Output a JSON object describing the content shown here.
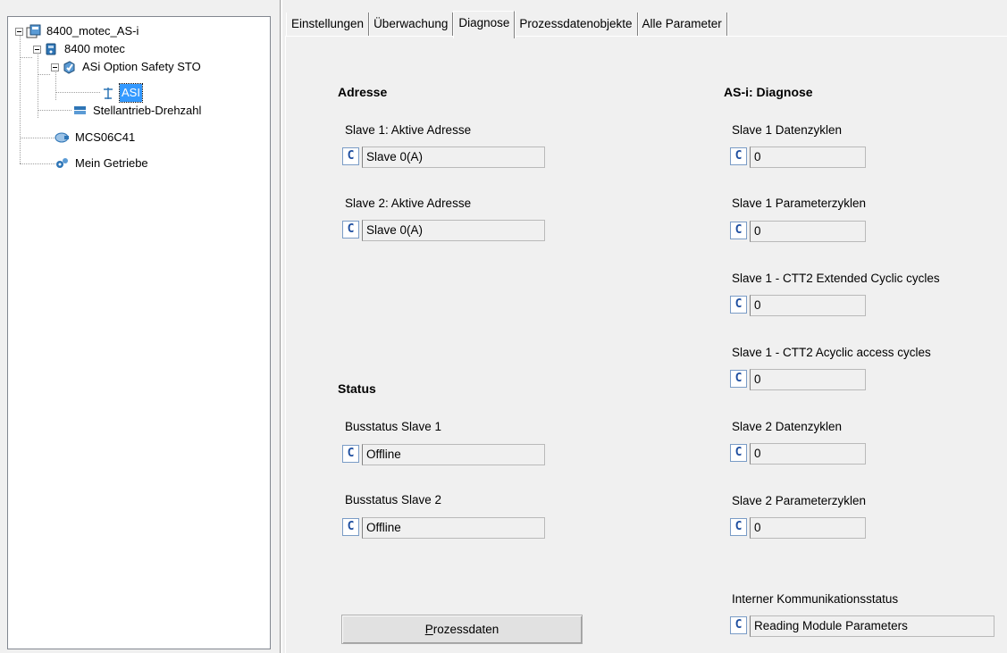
{
  "tree": {
    "nodes": [
      {
        "label": "8400_motec_AS-i",
        "icon": "project-icon"
      },
      {
        "label": "8400 motec",
        "icon": "drive-icon"
      },
      {
        "label": "ASi Option Safety STO",
        "icon": "module-icon"
      },
      {
        "label": "ASI",
        "icon": "antenna-icon",
        "selected": true
      },
      {
        "label": "Stellantrieb-Drehzahl",
        "icon": "application-icon"
      },
      {
        "label": "MCS06C41",
        "icon": "motor-icon"
      },
      {
        "label": "Mein Getriebe",
        "icon": "gearbox-icon"
      }
    ]
  },
  "tabs": [
    {
      "label": "Einstellungen"
    },
    {
      "label": "Überwachung"
    },
    {
      "label": "Diagnose",
      "active": true
    },
    {
      "label": "Prozessdatenobjekte"
    },
    {
      "label": "Alle Parameter"
    }
  ],
  "adresse": {
    "title": "Adresse",
    "fields": [
      {
        "label": "Slave 1: Aktive Adresse",
        "value": "Slave  0(A)"
      },
      {
        "label": "Slave 2: Aktive Adresse",
        "value": "Slave  0(A)"
      }
    ]
  },
  "status": {
    "title": "Status",
    "fields": [
      {
        "label": "Busstatus Slave 1",
        "value": "Offline"
      },
      {
        "label": "Busstatus Slave 2",
        "value": "Offline"
      }
    ]
  },
  "diagnose": {
    "title": "AS-i: Diagnose",
    "fields": [
      {
        "label": "Slave 1 Datenzyklen",
        "value": "0"
      },
      {
        "label": "Slave 1 Parameterzyklen",
        "value": "0"
      },
      {
        "label": "Slave 1 - CTT2 Extended Cyclic cycles",
        "value": "0"
      },
      {
        "label": "Slave 1 - CTT2 Acyclic access cycles",
        "value": "0"
      },
      {
        "label": "Slave 2 Datenzyklen",
        "value": "0"
      },
      {
        "label": "Slave 2 Parameterzyklen",
        "value": "0"
      }
    ],
    "comm_status": {
      "label": "Interner Kommunikationsstatus",
      "value": "Reading Module Parameters"
    }
  },
  "c_button_label": "C",
  "prozessdaten_button": {
    "mnemonic": "P",
    "rest": "rozessdaten"
  }
}
